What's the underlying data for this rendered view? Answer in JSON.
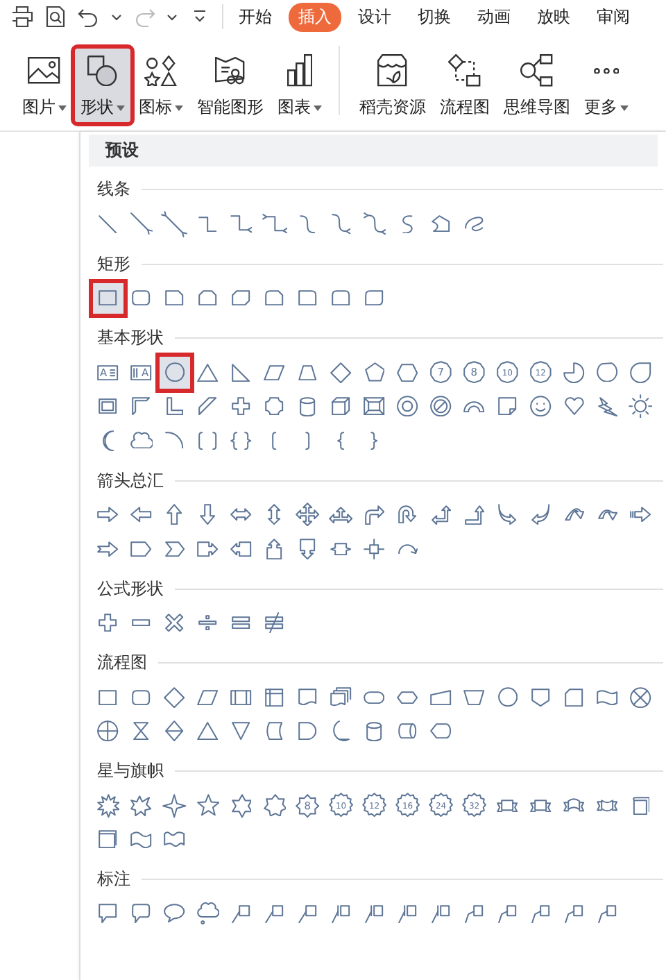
{
  "quick_access": [
    {
      "kind": "print"
    },
    {
      "kind": "preview"
    },
    {
      "kind": "undo"
    },
    {
      "kind": "caret"
    },
    {
      "kind": "redo"
    },
    {
      "kind": "caret"
    },
    {
      "kind": "customize"
    }
  ],
  "tabs": [
    {
      "label": "开始",
      "selected": false
    },
    {
      "label": "插入",
      "selected": true
    },
    {
      "label": "设计",
      "selected": false
    },
    {
      "label": "切换",
      "selected": false
    },
    {
      "label": "动画",
      "selected": false
    },
    {
      "label": "放映",
      "selected": false
    },
    {
      "label": "审阅",
      "selected": false
    }
  ],
  "ribbon": [
    {
      "kind": "picture",
      "label": "图片",
      "dropdown": true,
      "selected": false
    },
    {
      "kind": "shapes",
      "label": "形状",
      "dropdown": true,
      "selected": true
    },
    {
      "kind": "icons",
      "label": "图标",
      "dropdown": true,
      "selected": false
    },
    {
      "kind": "smartart",
      "label": "智能图形",
      "dropdown": false,
      "selected": false
    },
    {
      "kind": "chart",
      "label": "图表",
      "dropdown": true,
      "selected": false
    },
    {
      "kind": "store",
      "label": "稻壳资源",
      "dropdown": false,
      "selected": false
    },
    {
      "kind": "flowchart",
      "label": "流程图",
      "dropdown": false,
      "selected": false
    },
    {
      "kind": "mindmap",
      "label": "思维导图",
      "dropdown": false,
      "selected": false
    },
    {
      "kind": "more",
      "label": "更多",
      "dropdown": true,
      "selected": false
    }
  ],
  "panel": {
    "header": "预设",
    "sections": [
      {
        "title": "线条",
        "shapes": [
          {
            "kind": "line",
            "selected": false
          },
          {
            "kind": "arrow-line",
            "selected": false
          },
          {
            "kind": "double-arrow-line",
            "selected": false
          },
          {
            "kind": "elbow",
            "selected": false
          },
          {
            "kind": "elbow-arrow",
            "selected": false
          },
          {
            "kind": "elbow-double",
            "selected": false
          },
          {
            "kind": "curve",
            "selected": false
          },
          {
            "kind": "curve-arrow",
            "selected": false
          },
          {
            "kind": "curve-double",
            "selected": false
          },
          {
            "kind": "s-curve",
            "selected": false
          },
          {
            "kind": "freeform",
            "selected": false
          },
          {
            "kind": "scribble",
            "selected": false
          }
        ]
      },
      {
        "title": "矩形",
        "shapes": [
          {
            "kind": "rect",
            "selected": true
          },
          {
            "kind": "round-rect",
            "selected": false
          },
          {
            "kind": "snip",
            "selected": false
          },
          {
            "kind": "snip-two",
            "selected": false
          },
          {
            "kind": "snip-diag",
            "selected": false
          },
          {
            "kind": "snip-round",
            "selected": false
          },
          {
            "kind": "round-one",
            "selected": false
          },
          {
            "kind": "round-two",
            "selected": false
          },
          {
            "kind": "round-diag",
            "selected": false
          }
        ]
      },
      {
        "title": "基本形状",
        "shapes": [
          {
            "kind": "text-box",
            "label": "A",
            "selected": false
          },
          {
            "kind": "vertical-text",
            "label": "A",
            "selected": false
          },
          {
            "kind": "ellipse",
            "selected": true
          },
          {
            "kind": "triangle",
            "selected": false
          },
          {
            "kind": "right-triangle",
            "selected": false
          },
          {
            "kind": "parallelogram",
            "selected": false
          },
          {
            "kind": "trapezoid",
            "selected": false
          },
          {
            "kind": "diamond",
            "selected": false
          },
          {
            "kind": "pentagon",
            "selected": false
          },
          {
            "kind": "hexagon",
            "selected": false
          },
          {
            "kind": "polygon",
            "label": "7",
            "selected": false
          },
          {
            "kind": "polygon",
            "label": "8",
            "selected": false
          },
          {
            "kind": "polygon",
            "label": "10",
            "selected": false
          },
          {
            "kind": "polygon",
            "label": "12",
            "selected": false
          },
          {
            "kind": "pie",
            "selected": false
          },
          {
            "kind": "chord",
            "selected": false
          },
          {
            "kind": "teardrop",
            "selected": false
          },
          {
            "kind": "frame",
            "selected": false
          },
          {
            "kind": "half-frame",
            "selected": false
          },
          {
            "kind": "l-shape",
            "selected": false
          },
          {
            "kind": "diagonal-stripe",
            "selected": false
          },
          {
            "kind": "cross",
            "selected": false
          },
          {
            "kind": "plaque",
            "selected": false
          },
          {
            "kind": "can",
            "selected": false
          },
          {
            "kind": "cube",
            "selected": false
          },
          {
            "kind": "bevel",
            "selected": false
          },
          {
            "kind": "donut",
            "selected": false
          },
          {
            "kind": "no-symbol",
            "selected": false
          },
          {
            "kind": "block-arc",
            "selected": false
          },
          {
            "kind": "folded-corner",
            "selected": false
          },
          {
            "kind": "smiley",
            "selected": false
          },
          {
            "kind": "heart",
            "selected": false
          },
          {
            "kind": "lightning",
            "selected": false
          },
          {
            "kind": "sun",
            "selected": false
          },
          {
            "kind": "moon",
            "selected": false
          },
          {
            "kind": "cloud",
            "selected": false
          },
          {
            "kind": "arc",
            "selected": false
          },
          {
            "kind": "bracket-pair",
            "selected": false
          },
          {
            "kind": "brace-pair",
            "selected": false
          },
          {
            "kind": "left-bracket",
            "selected": false
          },
          {
            "kind": "right-bracket",
            "selected": false
          },
          {
            "kind": "left-brace",
            "selected": false
          },
          {
            "kind": "right-brace",
            "selected": false
          }
        ]
      },
      {
        "title": "箭头总汇",
        "shapes": [
          {
            "kind": "arrow-right",
            "selected": false
          },
          {
            "kind": "arrow-left",
            "selected": false
          },
          {
            "kind": "arrow-up",
            "selected": false
          },
          {
            "kind": "arrow-down",
            "selected": false
          },
          {
            "kind": "arrow-left-right",
            "selected": false
          },
          {
            "kind": "arrow-up-down",
            "selected": false
          },
          {
            "kind": "arrow-quad",
            "selected": false
          },
          {
            "kind": "arrow-three",
            "selected": false
          },
          {
            "kind": "arrow-bent",
            "selected": false
          },
          {
            "kind": "arrow-u-turn",
            "selected": false
          },
          {
            "kind": "arrow-left-up",
            "selected": false
          },
          {
            "kind": "arrow-bent-up",
            "selected": false
          },
          {
            "kind": "arrow-curved-right",
            "selected": false
          },
          {
            "kind": "arrow-curved-left",
            "selected": false
          },
          {
            "kind": "arrow-curved-up",
            "selected": false
          },
          {
            "kind": "arrow-curved-down",
            "selected": false
          },
          {
            "kind": "arrow-striped",
            "selected": false
          },
          {
            "kind": "arrow-notched",
            "selected": false
          },
          {
            "kind": "pentagon-arrow",
            "selected": false
          },
          {
            "kind": "chevron",
            "selected": false
          },
          {
            "kind": "callout-arrow-right",
            "selected": false
          },
          {
            "kind": "callout-arrow-left",
            "selected": false
          },
          {
            "kind": "callout-arrow-up",
            "selected": false
          },
          {
            "kind": "callout-arrow-down",
            "selected": false
          },
          {
            "kind": "callout-arrow-left-right",
            "selected": false
          },
          {
            "kind": "callout-arrow-quad",
            "selected": false
          },
          {
            "kind": "arrow-circular",
            "selected": false
          }
        ]
      },
      {
        "title": "公式形状",
        "shapes": [
          {
            "kind": "plus",
            "selected": false
          },
          {
            "kind": "minus",
            "selected": false
          },
          {
            "kind": "multiply",
            "selected": false
          },
          {
            "kind": "divide",
            "selected": false
          },
          {
            "kind": "equal",
            "selected": false
          },
          {
            "kind": "not-equal",
            "selected": false
          }
        ]
      },
      {
        "title": "流程图",
        "shapes": [
          {
            "kind": "rect",
            "selected": false
          },
          {
            "kind": "round-rect",
            "selected": false
          },
          {
            "kind": "diamond",
            "selected": false
          },
          {
            "kind": "parallelogram",
            "selected": false
          },
          {
            "kind": "predefined",
            "selected": false
          },
          {
            "kind": "internal-storage",
            "selected": false
          },
          {
            "kind": "document",
            "selected": false
          },
          {
            "kind": "multi-document",
            "selected": false
          },
          {
            "kind": "terminator",
            "selected": false
          },
          {
            "kind": "preparation",
            "selected": false
          },
          {
            "kind": "manual-input",
            "selected": false
          },
          {
            "kind": "manual-operation",
            "selected": false
          },
          {
            "kind": "ellipse",
            "selected": false
          },
          {
            "kind": "off-page",
            "selected": false
          },
          {
            "kind": "card",
            "selected": false
          },
          {
            "kind": "punched-tape",
            "selected": false
          },
          {
            "kind": "summing-junction",
            "selected": false
          },
          {
            "kind": "or",
            "selected": false
          },
          {
            "kind": "collate",
            "selected": false
          },
          {
            "kind": "sort",
            "selected": false
          },
          {
            "kind": "triangle",
            "selected": false
          },
          {
            "kind": "merge",
            "selected": false
          },
          {
            "kind": "stored-data",
            "selected": false
          },
          {
            "kind": "delay",
            "selected": false
          },
          {
            "kind": "sequential-access",
            "selected": false
          },
          {
            "kind": "can",
            "selected": false
          },
          {
            "kind": "direct-access",
            "selected": false
          },
          {
            "kind": "display",
            "selected": false
          }
        ]
      },
      {
        "title": "星与旗帜",
        "shapes": [
          {
            "kind": "explosion",
            "selected": false
          },
          {
            "kind": "explosion-two",
            "selected": false
          },
          {
            "kind": "star-four",
            "selected": false
          },
          {
            "kind": "star-five",
            "selected": false
          },
          {
            "kind": "star-six",
            "selected": false
          },
          {
            "kind": "star-seven",
            "selected": false
          },
          {
            "kind": "star-eight",
            "label": "8",
            "selected": false
          },
          {
            "kind": "star-many",
            "label": "10",
            "selected": false
          },
          {
            "kind": "star-many",
            "label": "12",
            "selected": false
          },
          {
            "kind": "star-many",
            "label": "16",
            "selected": false
          },
          {
            "kind": "star-many",
            "label": "24",
            "selected": false
          },
          {
            "kind": "star-many",
            "label": "32",
            "selected": false
          },
          {
            "kind": "ribbon-up",
            "selected": false
          },
          {
            "kind": "ribbon-down",
            "selected": false
          },
          {
            "kind": "ribbon-curved",
            "selected": false
          },
          {
            "kind": "ribbon-curved-down",
            "selected": false
          },
          {
            "kind": "scroll-vertical",
            "selected": false
          },
          {
            "kind": "scroll-horizontal",
            "selected": false
          },
          {
            "kind": "wave",
            "selected": false
          },
          {
            "kind": "double-wave",
            "selected": false
          }
        ]
      },
      {
        "title": "标注",
        "shapes": [
          {
            "kind": "callout-rect",
            "selected": false
          },
          {
            "kind": "callout-round",
            "selected": false
          },
          {
            "kind": "callout-oval",
            "selected": false
          },
          {
            "kind": "callout-cloud",
            "selected": false
          },
          {
            "kind": "callout-line",
            "selected": false
          },
          {
            "kind": "callout-line",
            "selected": false
          },
          {
            "kind": "callout-line",
            "selected": false
          },
          {
            "kind": "callout-bar",
            "selected": false
          },
          {
            "kind": "callout-bar",
            "selected": false
          },
          {
            "kind": "callout-bar",
            "selected": false
          },
          {
            "kind": "callout-bar",
            "selected": false
          },
          {
            "kind": "callout-border",
            "selected": false
          },
          {
            "kind": "callout-border",
            "selected": false
          },
          {
            "kind": "callout-border",
            "selected": false
          },
          {
            "kind": "callout-border",
            "selected": false
          },
          {
            "kind": "callout-border",
            "selected": false
          }
        ]
      }
    ]
  }
}
